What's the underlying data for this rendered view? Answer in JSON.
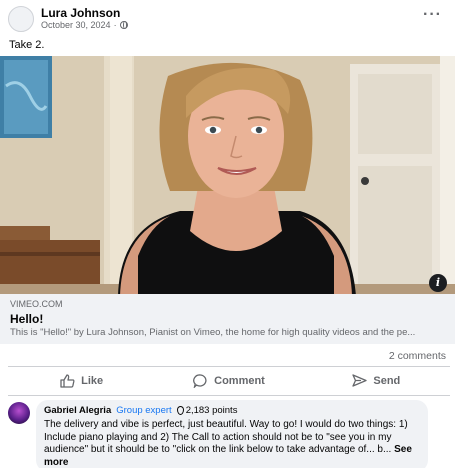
{
  "post": {
    "author": "Lura Johnson",
    "date": "October 30, 2024",
    "privacy_icon": "globe-icon",
    "menu_icon": "more-horizontal-icon",
    "text": "Take 2."
  },
  "link_preview": {
    "domain": "VIMEO.COM",
    "title": "Hello!",
    "description": "This is \"Hello!\" by Lura Johnson, Pianist on Vimeo, the home for high quality videos and the pe..."
  },
  "stats": {
    "comments": "2 comments"
  },
  "actions": {
    "like": "Like",
    "comment": "Comment",
    "send": "Send"
  },
  "comment": {
    "author": "Gabriel Alegria",
    "badge": "Group expert",
    "points": "2,183 points",
    "text": "The delivery and vibe is perfect, just beautiful. Way to go! I would do two things: 1) Include piano playing and 2) The Call to action should not be to \"see you in my audience\" but it should be to \"click on the link below to take advantage of... b...",
    "see_more": "See more"
  },
  "colors": {
    "brand_blue": "#1877f2",
    "secondary_text": "#65676b",
    "surface": "#f0f2f5"
  }
}
